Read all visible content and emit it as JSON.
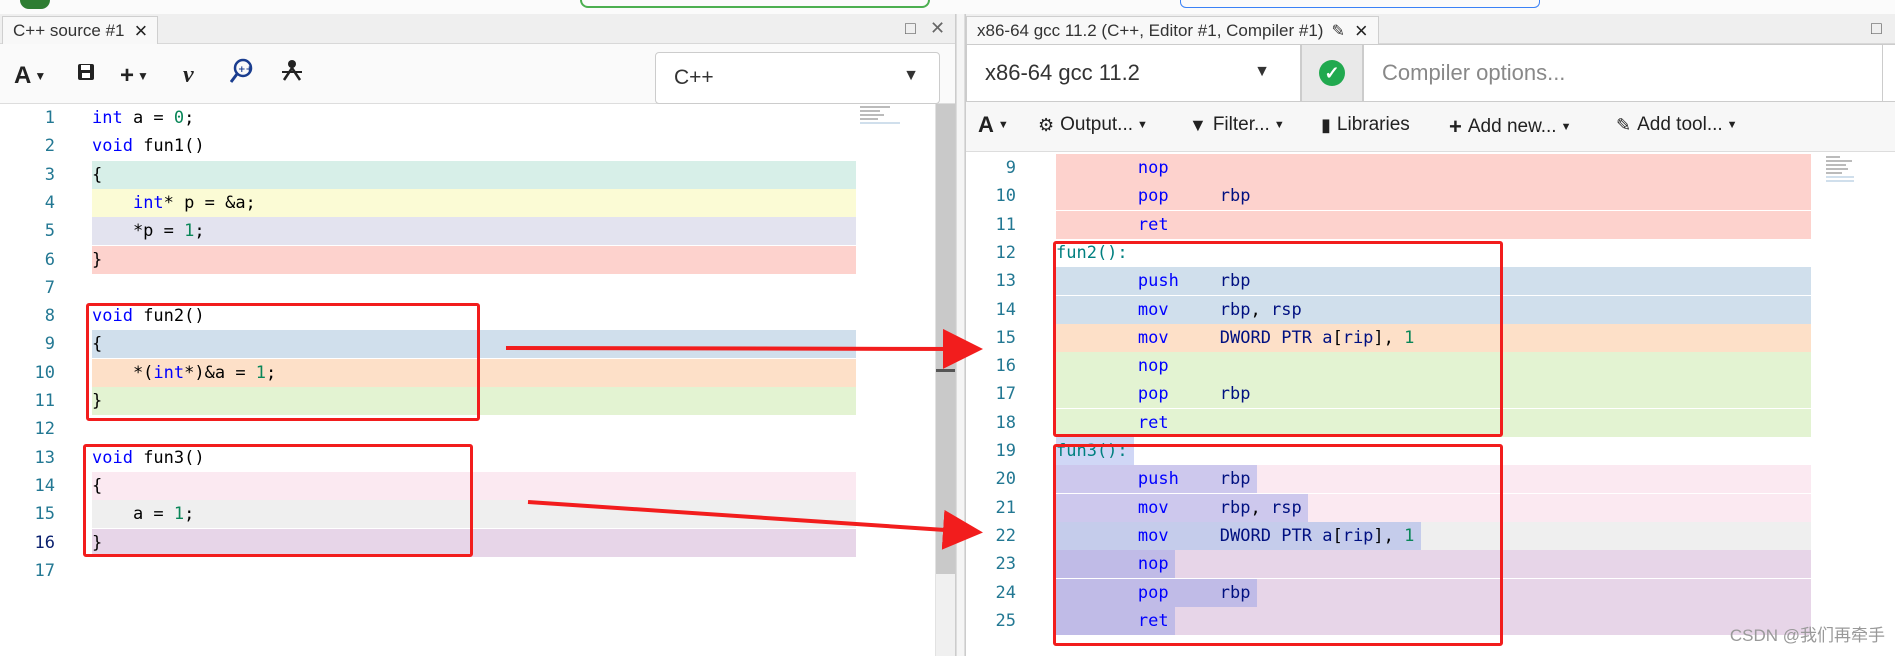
{
  "left_pane": {
    "tab_title": "C++ source #1",
    "tab_close": "×",
    "window_controls": [
      "□",
      "✕"
    ],
    "language": "C++",
    "toolbar_icons": [
      "font-icon",
      "save-icon",
      "add-icon",
      "vim-icon",
      "cppinsights-icon",
      "quick-bench-icon"
    ]
  },
  "right_pane": {
    "tab_title": "x86-64 gcc 11.2 (C++, Editor #1, Compiler #1)",
    "tab_close": "×",
    "window_control": "□",
    "compiler": "x86-64 gcc 11.2",
    "compiler_options_placeholder": "Compiler options...",
    "toolbar": {
      "output": "Output...",
      "filter": "Filter...",
      "libraries": "Libraries",
      "add_new": "Add new...",
      "add_tool": "Add tool..."
    }
  },
  "source_lines": [
    {
      "n": "1",
      "text": "int a = 0;"
    },
    {
      "n": "2",
      "text": "void fun1()"
    },
    {
      "n": "3",
      "text": "{"
    },
    {
      "n": "4",
      "text": "    int* p = &a;"
    },
    {
      "n": "5",
      "text": "    *p = 1;"
    },
    {
      "n": "6",
      "text": "}"
    },
    {
      "n": "7",
      "text": ""
    },
    {
      "n": "8",
      "text": "void fun2()"
    },
    {
      "n": "9",
      "text": "{"
    },
    {
      "n": "10",
      "text": "    *(int*)&a = 1;"
    },
    {
      "n": "11",
      "text": "}"
    },
    {
      "n": "12",
      "text": ""
    },
    {
      "n": "13",
      "text": "void fun3()"
    },
    {
      "n": "14",
      "text": "{"
    },
    {
      "n": "15",
      "text": "    a = 1;"
    },
    {
      "n": "16",
      "text": "}"
    },
    {
      "n": "17",
      "text": ""
    }
  ],
  "asm_lines": [
    {
      "n": "9",
      "text": "        nop"
    },
    {
      "n": "10",
      "text": "        pop     rbp"
    },
    {
      "n": "11",
      "text": "        ret"
    },
    {
      "n": "12",
      "text": "fun2():"
    },
    {
      "n": "13",
      "text": "        push    rbp"
    },
    {
      "n": "14",
      "text": "        mov     rbp, rsp"
    },
    {
      "n": "15",
      "text": "        mov     DWORD PTR a[rip], 1"
    },
    {
      "n": "16",
      "text": "        nop"
    },
    {
      "n": "17",
      "text": "        pop     rbp"
    },
    {
      "n": "18",
      "text": "        ret"
    },
    {
      "n": "19",
      "text": "fun3():"
    },
    {
      "n": "20",
      "text": "        push    rbp"
    },
    {
      "n": "21",
      "text": "        mov     rbp, rsp"
    },
    {
      "n": "22",
      "text": "        mov     DWORD PTR a[rip], 1"
    },
    {
      "n": "23",
      "text": "        nop"
    },
    {
      "n": "24",
      "text": "        pop     rbp"
    },
    {
      "n": "25",
      "text": "        ret"
    }
  ],
  "colors": {
    "block_fun1_open": "#d7efe8",
    "block_fun1_stmt1": "#fbfbd5",
    "block_fun1_stmt2": "#e3e3ef",
    "block_fun1_close": "#fdd2cd",
    "block_fun2_open": "#d0dfec",
    "block_fun2_stmt": "#fde0c8",
    "block_fun2_close": "#e3f3d2",
    "block_fun3_open": "#fbe9f1",
    "block_fun3_stmt": "#efefef",
    "block_fun3_close": "#e7d5e8",
    "annotation_red": "#f21d1d"
  },
  "watermark": "CSDN @我们再牵手"
}
